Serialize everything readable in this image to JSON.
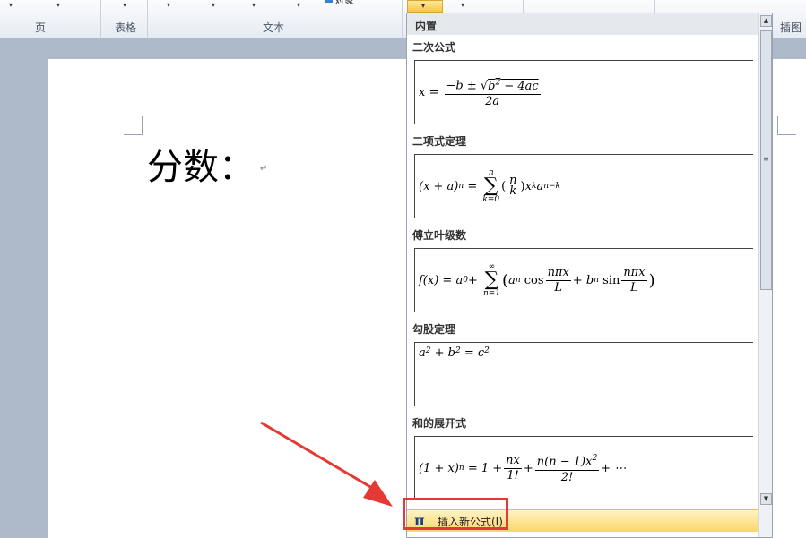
{
  "ribbon": {
    "groups": [
      {
        "label": "页"
      },
      {
        "label": "表格"
      },
      {
        "label": "文本"
      },
      {
        "label": "插图"
      }
    ],
    "object_label": "对象",
    "equation_dropdown_icon": "chevron-down-icon"
  },
  "document": {
    "text": "分数：",
    "paragraph_mark": "↵"
  },
  "equation_panel": {
    "header": "内置",
    "sections": [
      {
        "title": "二次公式",
        "formula": "x = (−b ± √(b² − 4ac)) / 2a"
      },
      {
        "title": "二项式定理",
        "formula": "(x + a)^n = Σ_{k=0}^{n} (n k) x^k a^{n−k}"
      },
      {
        "title": "傅立叶级数",
        "formula": "f(x) = a₀ + Σ_{n=1}^{∞} (aₙ cos nπx/L + bₙ sin nπx/L)"
      },
      {
        "title": "勾股定理",
        "formula": "a² + b² = c²"
      },
      {
        "title": "和的展开式",
        "formula": "(1 + x)^n = 1 + nx/1! + n(n − 1)x²/2! + ⋯"
      }
    ],
    "insert_new": "插入新公式(I)",
    "insert_icon": "pi-icon"
  },
  "colors": {
    "highlight": "#fbd76a",
    "callout": "#e53935"
  }
}
